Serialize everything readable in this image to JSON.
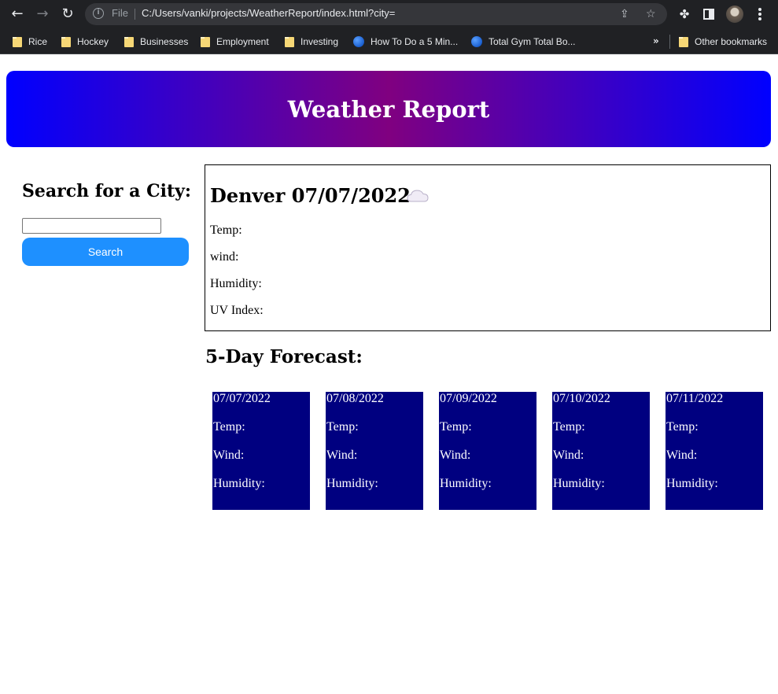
{
  "browser": {
    "url_scheme": "File",
    "url": "C:/Users/vanki/projects/WeatherReport/index.html?city=",
    "bookmarks": [
      {
        "label": "Rice",
        "icon": "folder-icon"
      },
      {
        "label": "Hockey",
        "icon": "folder-icon"
      },
      {
        "label": "Businesses",
        "icon": "folder-icon"
      },
      {
        "label": "Employment",
        "icon": "folder-icon"
      },
      {
        "label": "Investing",
        "icon": "folder-icon"
      },
      {
        "label": "How To Do a 5 Min...",
        "icon": "globe-icon"
      },
      {
        "label": "Total Gym Total Bo...",
        "icon": "globe-icon"
      }
    ],
    "more_bookmarks": "»",
    "other_bookmarks": "Other bookmarks"
  },
  "header": {
    "title": "Weather Report",
    "gradient_colors": [
      "#0000ff",
      "#800080",
      "#0000ff"
    ]
  },
  "search": {
    "heading": "Search for a City:",
    "input_value": "",
    "button_label": "Search",
    "button_color": "#1e90ff"
  },
  "current": {
    "title": "Denver 07/07/2022",
    "icon": "cloud-icon",
    "temp_label": "Temp:",
    "wind_label": "wind:",
    "humidity_label": "Humidity:",
    "uv_label": "UV Index:"
  },
  "forecast": {
    "heading": "5-Day Forecast:",
    "card_color": "#000080",
    "days": [
      {
        "date": "07/07/2022",
        "temp": "Temp:",
        "wind": "Wind:",
        "humidity": "Humidity:"
      },
      {
        "date": "07/08/2022",
        "temp": "Temp:",
        "wind": "Wind:",
        "humidity": "Humidity:"
      },
      {
        "date": "07/09/2022",
        "temp": "Temp:",
        "wind": "Wind:",
        "humidity": "Humidity:"
      },
      {
        "date": "07/10/2022",
        "temp": "Temp:",
        "wind": "Wind:",
        "humidity": "Humidity:"
      },
      {
        "date": "07/11/2022",
        "temp": "Temp:",
        "wind": "Wind:",
        "humidity": "Humidity:"
      }
    ]
  }
}
